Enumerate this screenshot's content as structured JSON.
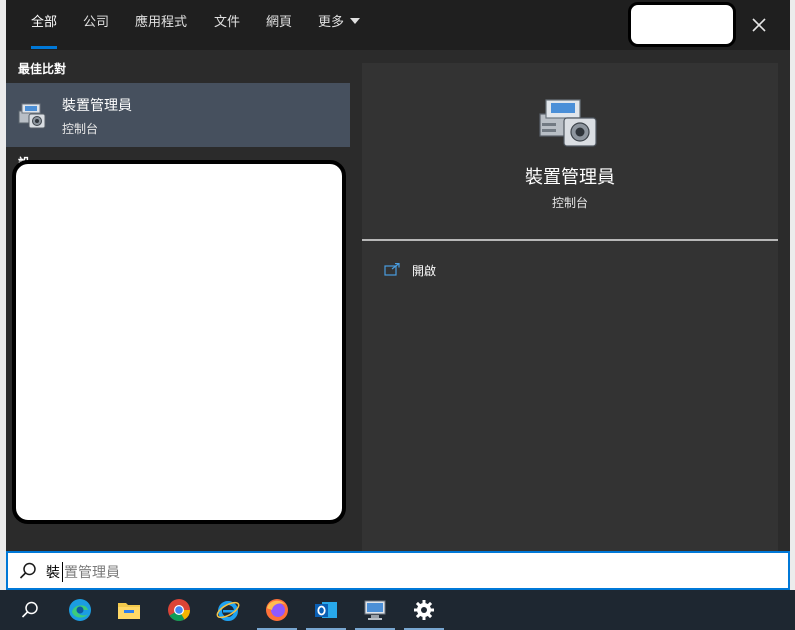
{
  "tabs": [
    {
      "label": "全部",
      "active": true
    },
    {
      "label": "公司",
      "active": false
    },
    {
      "label": "應用程式",
      "active": false
    },
    {
      "label": "文件",
      "active": false
    },
    {
      "label": "網頁",
      "active": false
    },
    {
      "label": "更多",
      "active": false
    }
  ],
  "close_icon": "close-icon",
  "best_match": {
    "heading": "最佳比對",
    "title": "裝置管理員",
    "subtitle": "控制台",
    "icon": "device-manager-icon"
  },
  "settings_heading": "設",
  "preview": {
    "title": "裝置管理員",
    "subtitle": "控制台",
    "actions": [
      {
        "label": "開啟",
        "icon": "open-icon"
      }
    ]
  },
  "search": {
    "typed": "裝",
    "suggestion": "置管理員",
    "icon": "search-icon"
  },
  "taskbar": {
    "items": [
      {
        "name": "search-taskbar-icon",
        "running": false
      },
      {
        "name": "edge-icon",
        "running": false
      },
      {
        "name": "file-explorer-icon",
        "running": false
      },
      {
        "name": "chrome-icon",
        "running": false
      },
      {
        "name": "internet-explorer-icon",
        "running": false
      },
      {
        "name": "firefox-icon",
        "running": true
      },
      {
        "name": "outlook-icon",
        "running": true
      },
      {
        "name": "device-manager-icon",
        "running": true
      },
      {
        "name": "settings-gear-icon",
        "running": true
      }
    ]
  },
  "colors": {
    "accent": "#0078d7",
    "selected_item": "#46505e",
    "flyout_bg": "#2b2b2b",
    "taskbar_bg": "#1e2731"
  }
}
